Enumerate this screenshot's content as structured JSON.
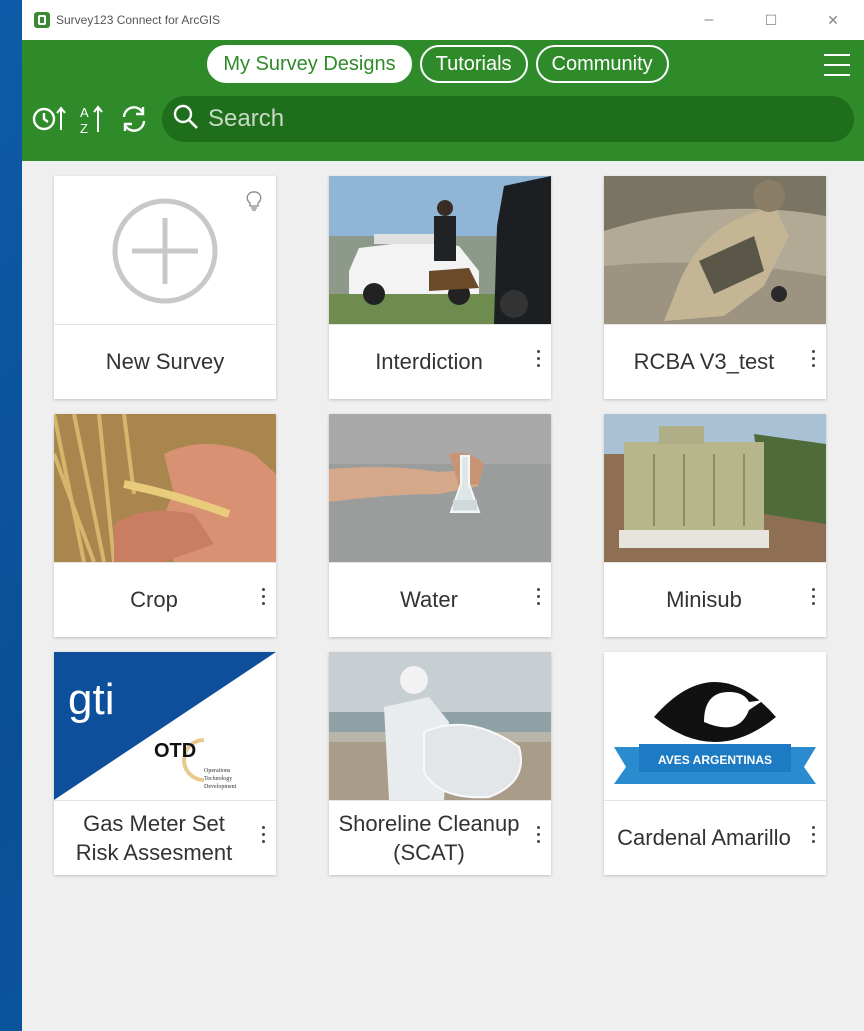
{
  "window": {
    "title": "Survey123 Connect for ArcGIS",
    "controls": [
      "–",
      "☐",
      "✕"
    ]
  },
  "tabs": [
    {
      "label": "My Survey Designs",
      "active": true
    },
    {
      "label": "Tutorials",
      "active": false
    },
    {
      "label": "Community",
      "active": false
    }
  ],
  "search": {
    "placeholder": "Search",
    "value": ""
  },
  "cards": [
    {
      "label": "New Survey",
      "icon": "plus-circle-icon"
    },
    {
      "label": "Interdiction"
    },
    {
      "label": "RCBA V3_test"
    },
    {
      "label": "Crop"
    },
    {
      "label": "Water"
    },
    {
      "label": "Minisub"
    },
    {
      "label": "Gas Meter Set Risk Assesment",
      "logo_text": {
        "main": "gti",
        "sub": "OTD",
        "caption": "Operations Technology Development"
      }
    },
    {
      "label": "Shoreline Cleanup (SCAT)"
    },
    {
      "label": "Cardenal Amarillo",
      "logo_text": {
        "banner": "AVES ARGENTINAS"
      }
    }
  ],
  "colors": {
    "header": "#2f8a2a",
    "search_bg": "#1e6e1c",
    "background": "#efefef"
  }
}
